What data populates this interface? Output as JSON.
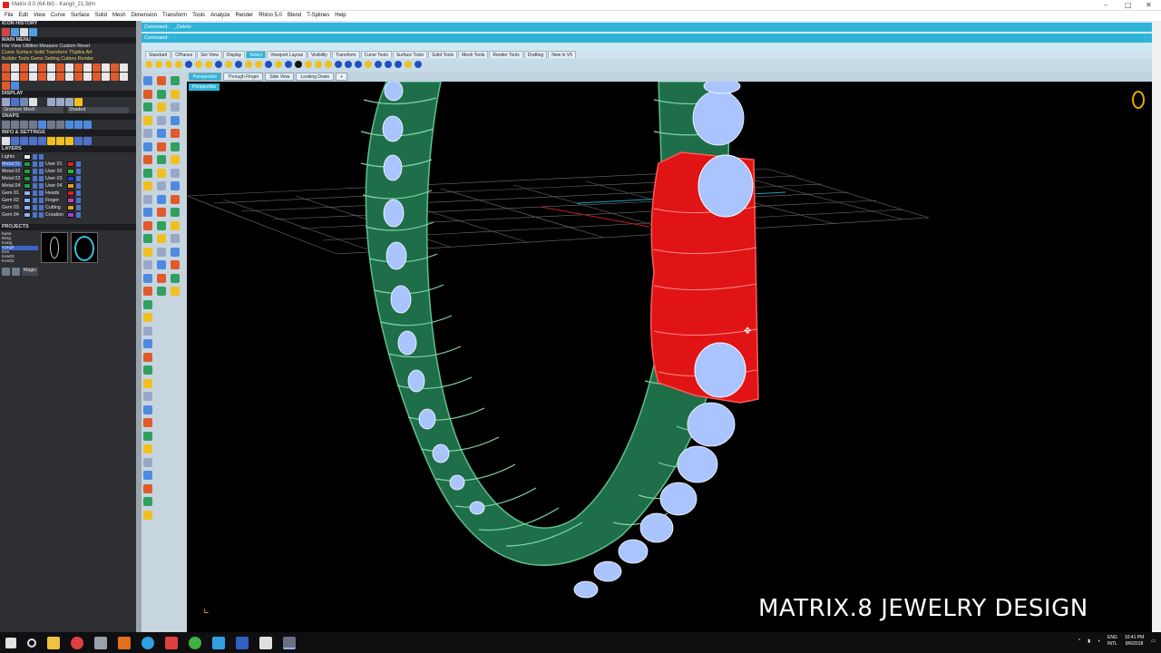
{
  "window": {
    "title": "Matrix 8.0 (64-bit) - Kangil_21.3dm",
    "controls": [
      "–",
      "□",
      "✕"
    ]
  },
  "menubar": [
    "File",
    "Edit",
    "View",
    "Curve",
    "Surface",
    "Solid",
    "Mesh",
    "Dimension",
    "Transform",
    "Tools",
    "Analyze",
    "Render",
    "Rhino 5.0",
    "Blend",
    "T-Splines",
    "Help"
  ],
  "left_panel": {
    "icon_history_label": "ICON HISTORY",
    "main_menu_label": "MAIN MENU",
    "main_menu_row1": "File  View  Utilities  Measure  Custom       Reset",
    "main_menu_row2": "Curve  Surface  Solid  Transform  TSplins  Art",
    "main_menu_row3": "Builder  Tools  Gems  Setting  Cutters  Render",
    "display_label": "DISPLAY",
    "display_modes": [
      "Gnomon Mesh",
      "Shaded"
    ],
    "snaps_label": "SNAPS",
    "info_label": "INFO & SETTINGS",
    "layers_label": "LAYERS",
    "layers": [
      {
        "name": "Lights",
        "color": "#e8e8e8",
        "name2": "",
        "color2": ""
      },
      {
        "name": "Metal 01",
        "color": "#20a040",
        "name2": "User 01",
        "color2": "#e02020"
      },
      {
        "name": "Metal 02",
        "color": "#20a040",
        "name2": "User 02",
        "color2": "#20c020"
      },
      {
        "name": "Metal 03",
        "color": "#20a040",
        "name2": "User 03",
        "color2": "#2040e0"
      },
      {
        "name": "Metal 04",
        "color": "#20a040",
        "name2": "User 04",
        "color2": "#e0a020"
      },
      {
        "name": "Gem 01",
        "color": "#8ab4ff",
        "name2": "Heads",
        "color2": "#e02020"
      },
      {
        "name": "Gem 02",
        "color": "#8ab4ff",
        "name2": "Finger",
        "color2": "#c040c0"
      },
      {
        "name": "Gem 03",
        "color": "#8ab4ff",
        "name2": "Cutting",
        "color2": "#e0a020"
      },
      {
        "name": "Gem 04",
        "color": "#8ab4ff",
        "name2": "Creation",
        "color2": "#a040e0"
      }
    ],
    "projects_label": "PROJECTS",
    "projects": [
      "base",
      "Ring",
      "Kang",
      "Kangil",
      "Kev",
      "Kev03",
      "Kev02"
    ],
    "projects_button": "Magic"
  },
  "command": {
    "line1_label": "Command:",
    "line1_value": "_Delete",
    "line2_label": "Command:",
    "line2_value": ""
  },
  "tabs": [
    "Standard",
    "CPlanes",
    "Set View",
    "Display",
    "Select",
    "Viewport Layout",
    "Visibility",
    "Transform",
    "Curve Tools",
    "Surface Tools",
    "Solid Tools",
    "Mesh Tools",
    "Render Tools",
    "Drafting",
    "New in V5"
  ],
  "active_tab": "Select",
  "viewport_tabs": [
    "Perspective",
    "Through Finger",
    "Side View",
    "Looking Down",
    "+"
  ],
  "active_viewport_tab": "Perspective",
  "viewport_label": "Perspective",
  "watermark": "MATRIX.8 JEWELRY DESIGN",
  "scene_colors": {
    "metal": "#1f6e4a",
    "metal_edge": "#5fbf8a",
    "selected": "#e01414",
    "gem": "#a9c4ff",
    "grid": "#8a8a8a"
  },
  "tray": {
    "lang1": "ENG",
    "lang2": "INTL",
    "time": "10:41 PM",
    "date": "8/6/2018"
  }
}
